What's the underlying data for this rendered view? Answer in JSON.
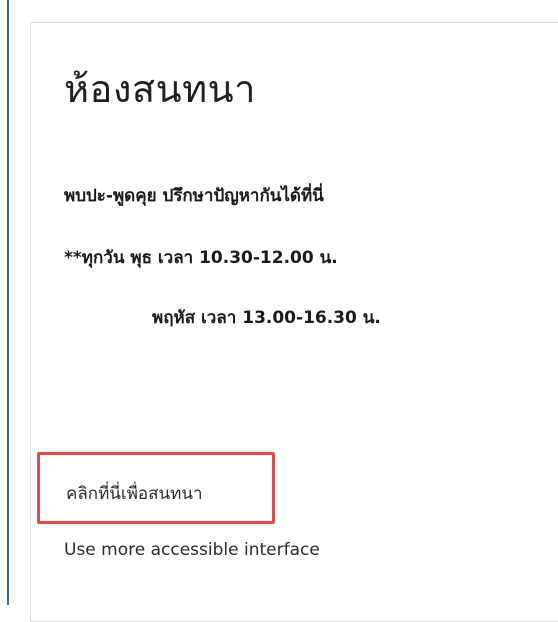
{
  "page": {
    "title": "ห้องสนทนา"
  },
  "intro": {
    "line1": "พบปะ-พูดคุย ปรึกษาปัญหากันได้ที่นี่",
    "line2": "**ทุกวัน พุธ เวลา 10.30-12.00 น.",
    "line3": "พฤหัส เวลา 13.00-16.30 น."
  },
  "links": {
    "chat": "คลิกที่นี่เพื่อสนทนา",
    "accessible": "Use more accessible interface"
  },
  "colors": {
    "edge_line": "#2f6fb0",
    "highlight": "#e14b4b",
    "text": "#1f1f1f"
  }
}
